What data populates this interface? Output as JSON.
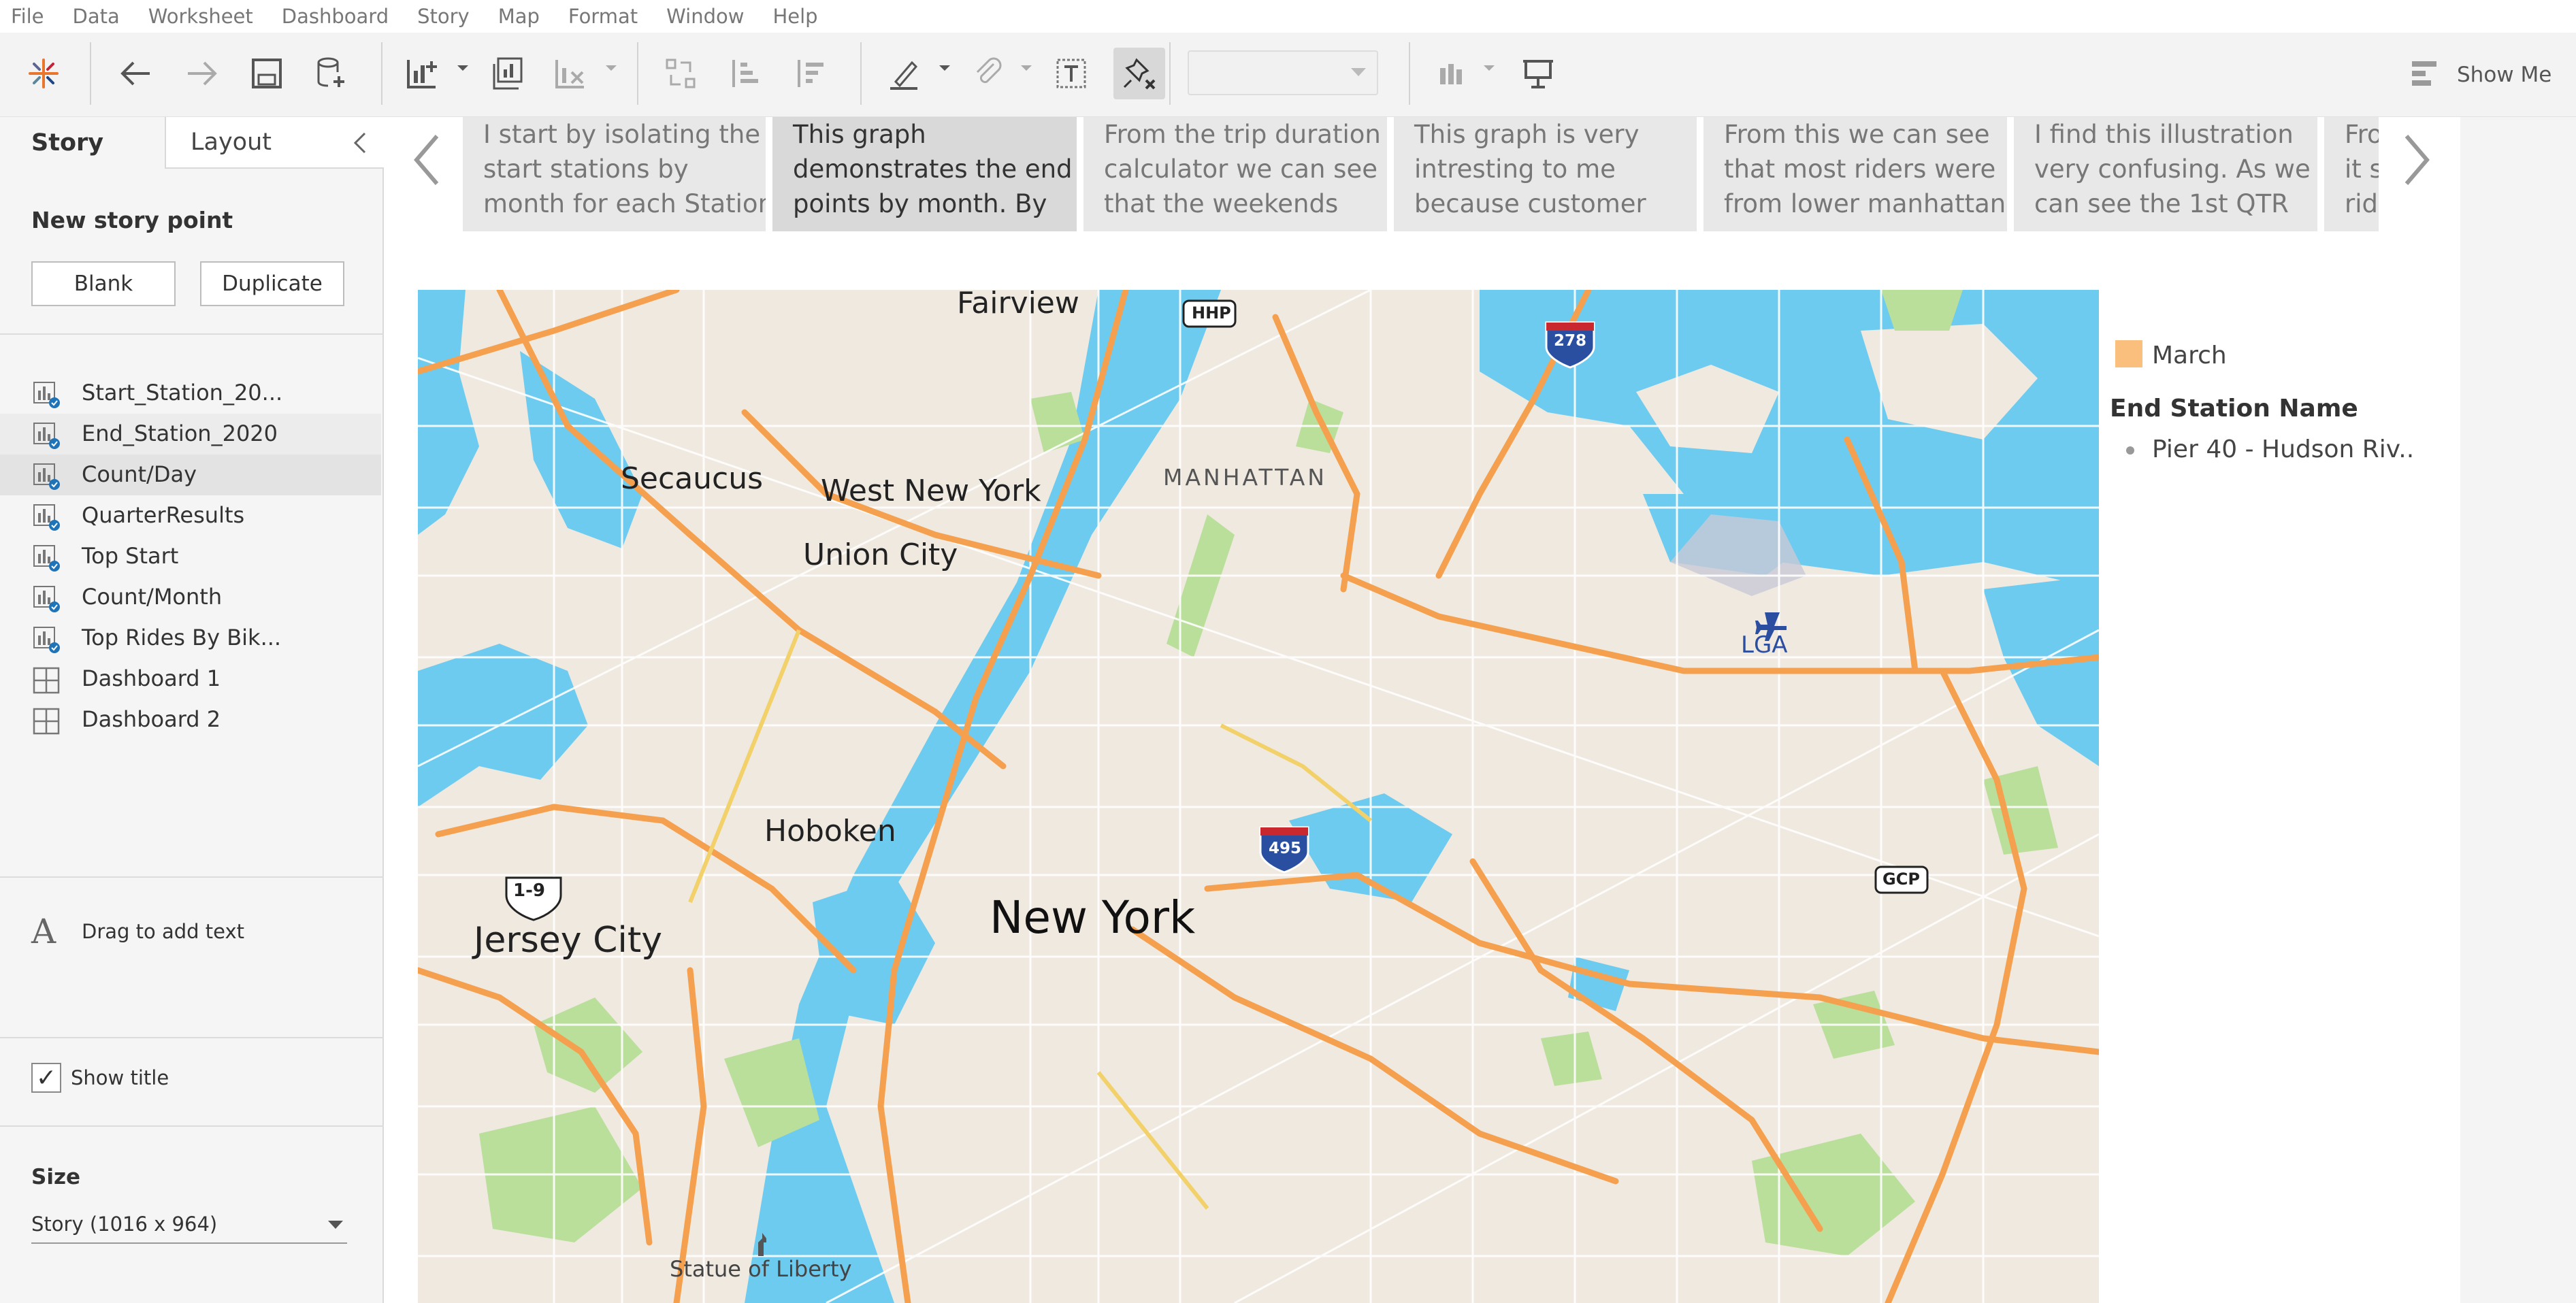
{
  "menu": [
    "File",
    "Data",
    "Worksheet",
    "Dashboard",
    "Story",
    "Map",
    "Format",
    "Window",
    "Help"
  ],
  "toolbar": {
    "show_me_label": "Show Me",
    "icons": [
      "tableau-logo-icon",
      "undo-icon",
      "redo-icon",
      "save-icon",
      "new-data-source-icon",
      "new-worksheet-icon",
      "duplicate-sheet-icon",
      "clear-sheet-icon",
      "swap-icon",
      "sort-ascending-icon",
      "sort-descending-icon",
      "highlight-icon",
      "attach-icon",
      "text-icon",
      "pin-icon",
      "chart-icon",
      "presentation-icon"
    ]
  },
  "sidebar": {
    "tab_story": "Story",
    "tab_layout": "Layout",
    "new_story_point": "New story point",
    "blank_button": "Blank",
    "duplicate_button": "Duplicate",
    "sheets": [
      {
        "label": "Start_Station_20...",
        "type": "worksheet"
      },
      {
        "label": "End_Station_2020",
        "type": "worksheet"
      },
      {
        "label": "Count/Day",
        "type": "worksheet"
      },
      {
        "label": "QuarterResults",
        "type": "worksheet"
      },
      {
        "label": "Top Start",
        "type": "worksheet"
      },
      {
        "label": "Count/Month",
        "type": "worksheet"
      },
      {
        "label": "Top Rides By Bik...",
        "type": "worksheet"
      },
      {
        "label": "Dashboard 1",
        "type": "dashboard"
      },
      {
        "label": "Dashboard 2",
        "type": "dashboard"
      }
    ],
    "drag_text": "Drag to add text",
    "show_title": "Show title",
    "show_title_checked": true,
    "size_label": "Size",
    "size_value": "Story (1016 x 964)"
  },
  "story_points": [
    {
      "lines": [
        "I start by isolating the",
        "start stations by",
        "month for each Station"
      ],
      "selected": false
    },
    {
      "lines": [
        "This graph",
        "demonstrates the end",
        "points by month. By"
      ],
      "selected": true
    },
    {
      "lines": [
        "From the trip duration",
        "calculator we can see",
        "that the weekends"
      ],
      "selected": false
    },
    {
      "lines": [
        "This graph is very",
        "intresting to me",
        "because customer"
      ],
      "selected": false
    },
    {
      "lines": [
        "From this we can see",
        "that most riders were",
        "from lower manhattan"
      ],
      "selected": false
    },
    {
      "lines": [
        "I find this illustration",
        "very confusing.  As we",
        "can see the 1st QTR"
      ],
      "selected": false
    },
    {
      "lines": [
        "Fro",
        "it s",
        "ride"
      ],
      "selected": false
    }
  ],
  "map": {
    "labels": {
      "fairview": "Fairview",
      "hhp": "HHP",
      "i278": "278",
      "secaucus": "Secaucus",
      "west_new_york": "West New York",
      "manhattan": "MANHATTAN",
      "union_city": "Union City",
      "lga": "LGA",
      "hoboken": "Hoboken",
      "i495": "495",
      "gcp": "GCP",
      "r19": "1-9",
      "jersey_city": "Jersey City",
      "new_york": "New York",
      "statue_of_liberty": "Statue of Liberty"
    },
    "colors": {
      "water": "#6dcbf0",
      "land": "#efe9e0",
      "highway": "#f5a04e",
      "park": "#b9df9a"
    }
  },
  "legend": {
    "month": "March",
    "month_color": "#fbbf7d",
    "title": "End Station Name",
    "items": [
      "Pier 40 - Hudson Riv.."
    ]
  }
}
